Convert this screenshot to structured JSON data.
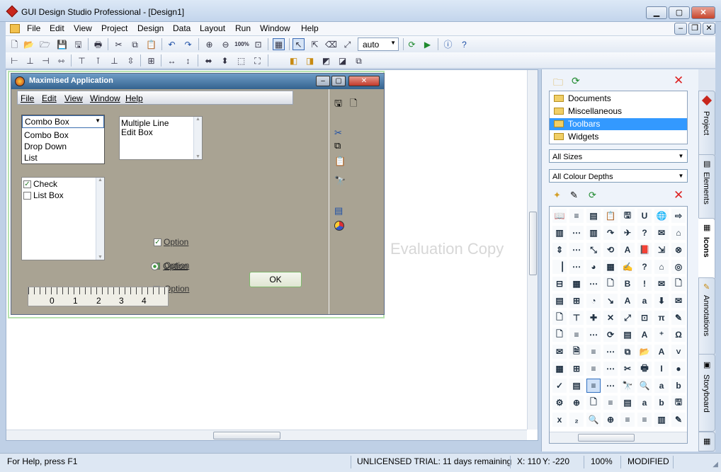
{
  "app": {
    "title": "GUI Design Studio Professional - [Design1]"
  },
  "window_buttons": {
    "minimize": "▁",
    "maximize": "▢",
    "close": "✕"
  },
  "menu": [
    "File",
    "Edit",
    "View",
    "Project",
    "Design",
    "Data",
    "Layout",
    "Run",
    "Window",
    "Help"
  ],
  "mdi_buttons": {
    "minimize": "–",
    "restore": "❐",
    "close": "✕"
  },
  "toolbar": {
    "zoom_value": "auto"
  },
  "mock_window": {
    "title": "Maximised Application",
    "menu": [
      "File",
      "Edit",
      "View",
      "Window",
      "Help"
    ],
    "combo": {
      "value": "Combo Box",
      "items": [
        "Combo Box",
        "Drop Down",
        "List"
      ]
    },
    "multiline": [
      "Multiple Line",
      "Edit Box"
    ],
    "checklist": [
      {
        "label": "Check",
        "checked": true
      },
      {
        "label": "List Box",
        "checked": false
      }
    ],
    "options": [
      "Option",
      "Option",
      "Option",
      "Option"
    ],
    "ok_label": "OK",
    "ruler_labels": [
      "0",
      "1",
      "2",
      "3",
      "4"
    ]
  },
  "watermark": "Evaluation Copy",
  "panel": {
    "folders": [
      "Documents",
      "Miscellaneous",
      "Toolbars",
      "Widgets"
    ],
    "selected_folder": "Toolbars",
    "sizes": "All Sizes",
    "colour_depths": "All Colour Depths"
  },
  "tabs": [
    "Project",
    "Elements",
    "Icons",
    "Annotations",
    "Storyboard"
  ],
  "status": {
    "help": "For Help, press F1",
    "trial": "UNLICENSED TRIAL: 11 days remaining",
    "x": "X: 110",
    "y": "Y: -220",
    "zoom": "100%",
    "state": "MODIFIED"
  }
}
